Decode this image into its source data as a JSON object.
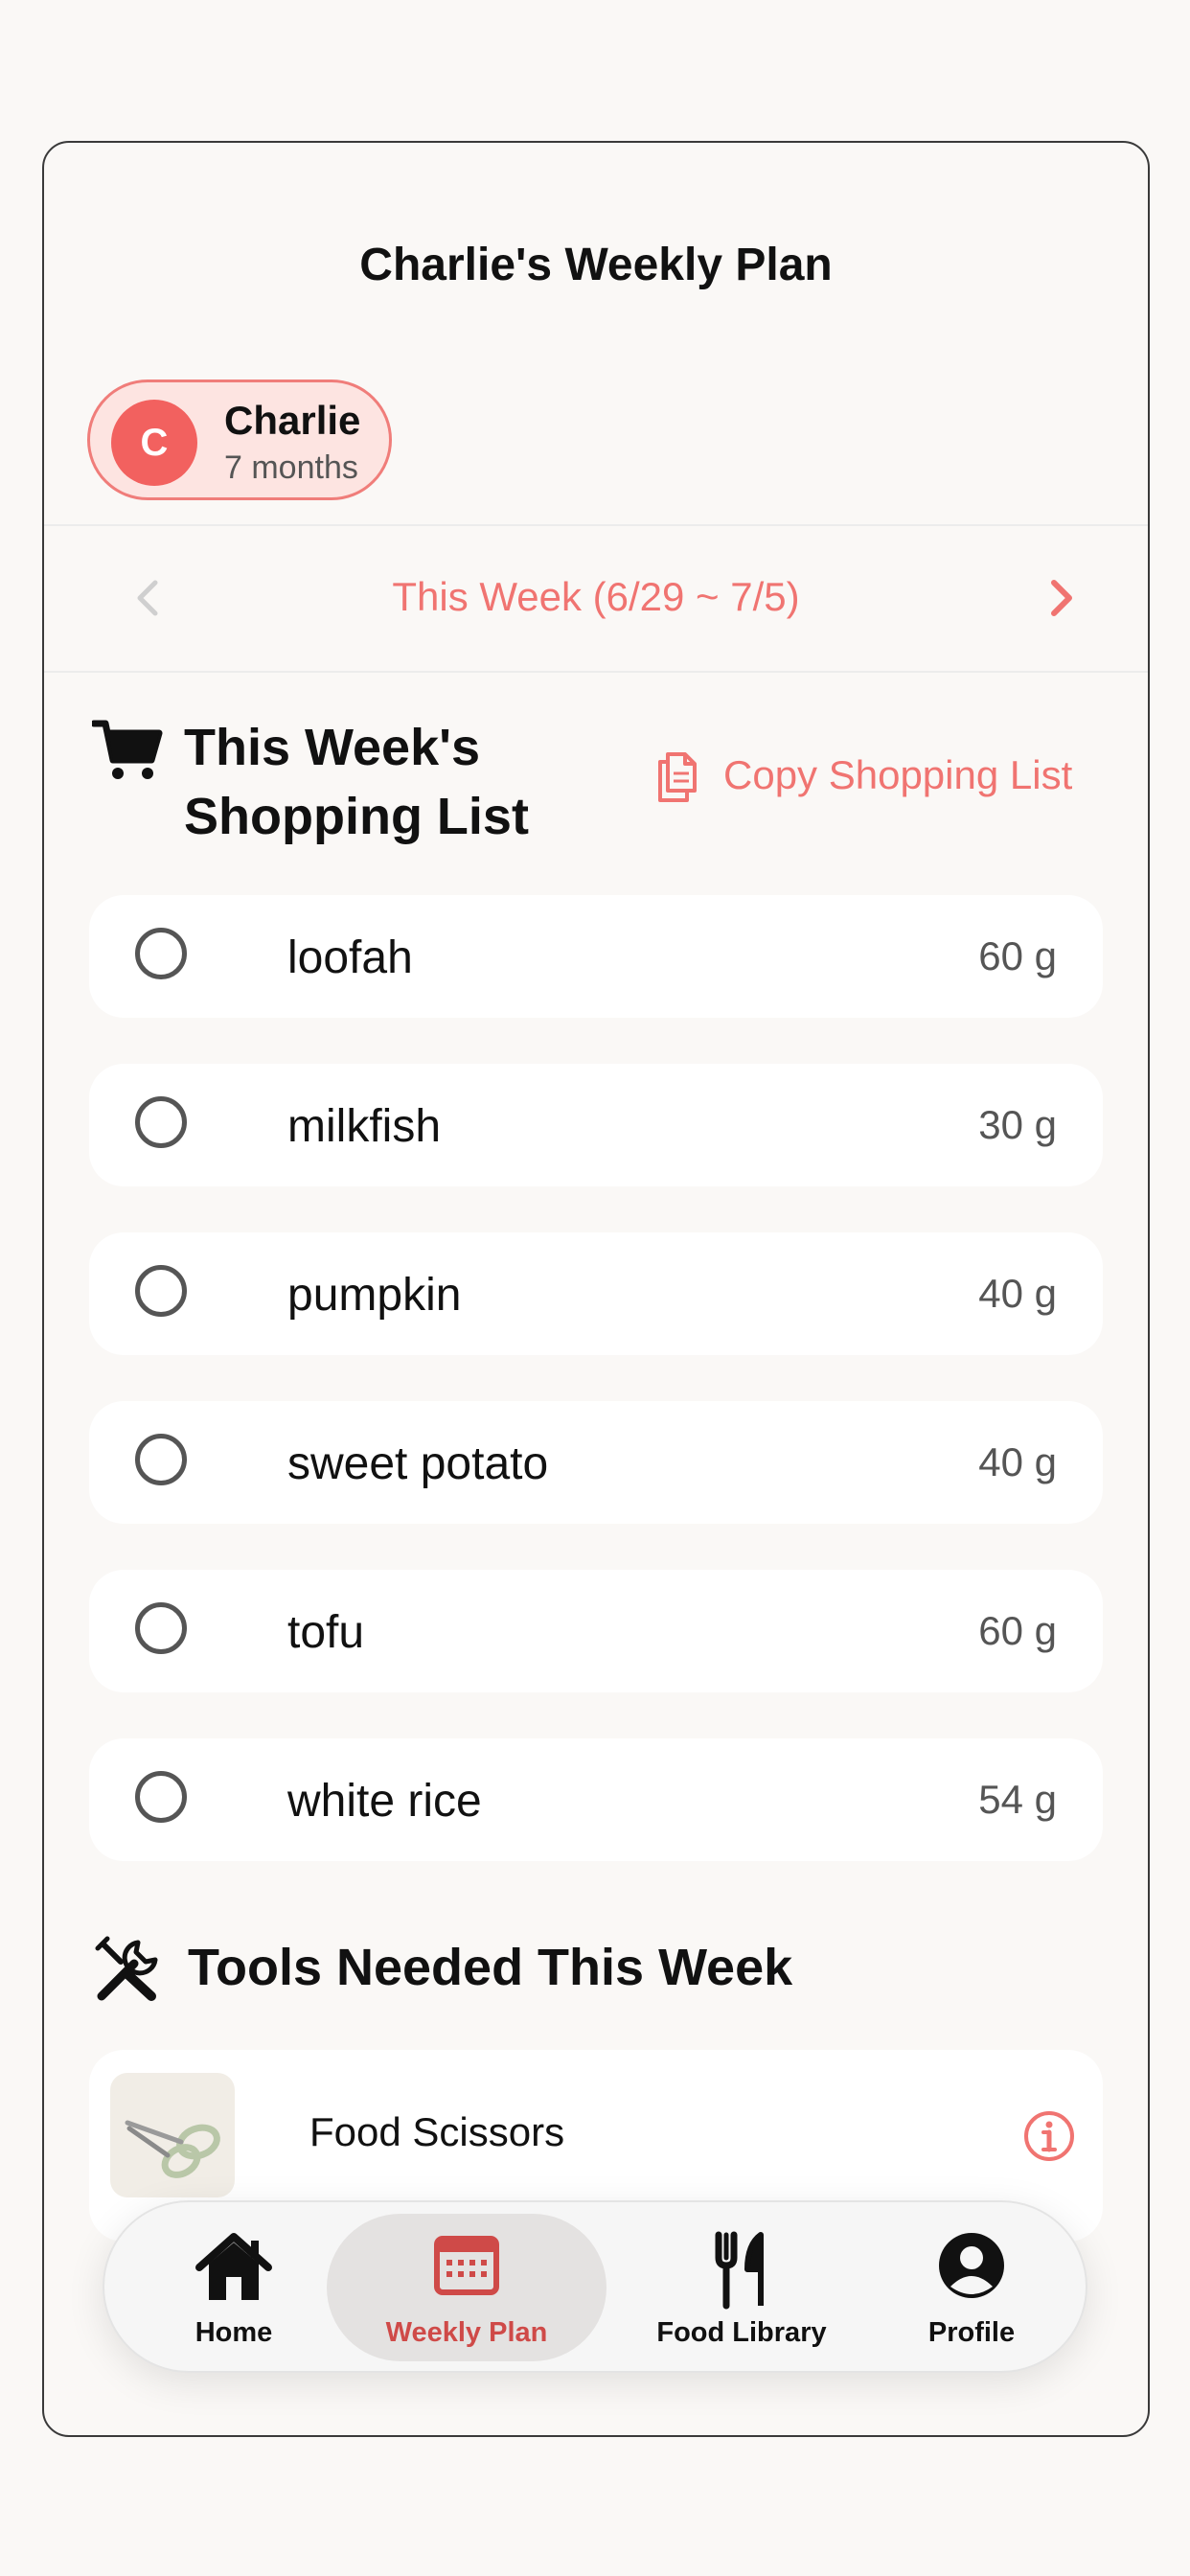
{
  "page_title": "Charlie's Weekly Plan",
  "profile": {
    "initial": "C",
    "name": "Charlie",
    "age": "7 months"
  },
  "week_nav": {
    "label": "This Week (6/29 ~ 7/5)"
  },
  "shopping": {
    "title_line1": "This Week's",
    "title_line2": "Shopping List",
    "copy_label": "Copy Shopping List",
    "items": [
      {
        "name": "loofah",
        "qty": "60 g"
      },
      {
        "name": "milkfish",
        "qty": "30 g"
      },
      {
        "name": "pumpkin",
        "qty": "40 g"
      },
      {
        "name": "sweet potato",
        "qty": "40 g"
      },
      {
        "name": "tofu",
        "qty": "60 g"
      },
      {
        "name": "white rice",
        "qty": "54 g"
      }
    ]
  },
  "tools": {
    "title": "Tools Needed This Week",
    "items": [
      {
        "name": "Food Scissors",
        "icon": "scissors-image"
      }
    ]
  },
  "tabbar": {
    "tabs": [
      {
        "label": "Home",
        "icon": "home-icon"
      },
      {
        "label": "Weekly Plan",
        "icon": "calendar-icon",
        "active": true
      },
      {
        "label": "Food Library",
        "icon": "fork-knife-icon"
      },
      {
        "label": "Profile",
        "icon": "person-icon"
      }
    ]
  },
  "colors": {
    "accent": "#f07471",
    "accent_dark": "#cf4a48",
    "chip_bg": "#fde4e1",
    "avatar": "#f2615f"
  }
}
